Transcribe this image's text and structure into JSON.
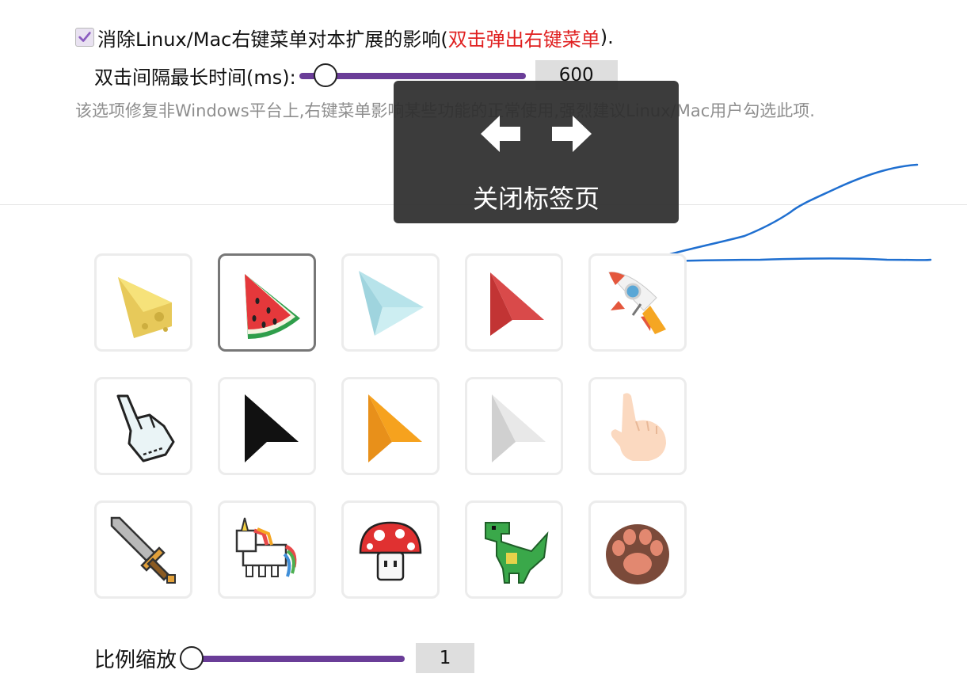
{
  "rightclick_fix": {
    "checked": true,
    "label_main": "消除Linux/Mac右键菜单对本扩展的影响(",
    "label_highlight": "双击弹出右键菜单",
    "label_end": ")."
  },
  "double_click_interval": {
    "label": "双击间隔最长时间(ms):",
    "value": "600"
  },
  "hint": "该选项修复非Windows平台上,右键菜单影响某些功能的正常使用,强烈建议Linux/Mac用户勾选此项.",
  "gesture_popup": {
    "arrows": [
      "left-arrow-icon",
      "right-arrow-icon"
    ],
    "label": "关闭标签页"
  },
  "cursors": {
    "selected": "watermelon",
    "items": [
      "cheese",
      "watermelon",
      "paper-plane",
      "red-arrow",
      "rocket",
      "pixel-hand",
      "black-arrow",
      "orange-arrow",
      "white-arrow",
      "pointing-hand",
      "pixel-sword",
      "pixel-unicorn",
      "pixel-mushroom",
      "pixel-dinosaur",
      "paw"
    ]
  },
  "scale": {
    "label": "比例缩放",
    "value": "1"
  },
  "colors": {
    "accent": "#6a3d98",
    "highlight_text": "#e02020",
    "stroke": "#1f6fd0",
    "popup_bg": "#2d2d2d"
  }
}
